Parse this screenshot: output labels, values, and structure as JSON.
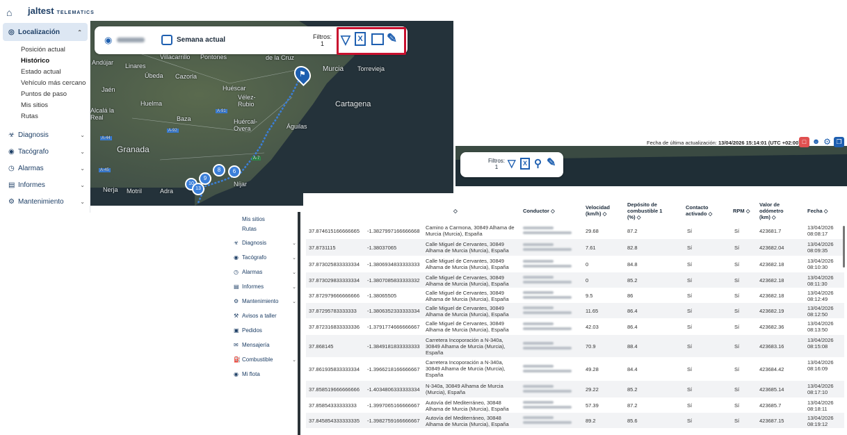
{
  "header": {
    "brand": "jaltest",
    "brand_tag": "TELEMATICS"
  },
  "sidebar": {
    "main_label": "Localización",
    "sub_items": [
      "Posición actual",
      "Histórico",
      "Estado actual",
      "Vehículo más cercano",
      "Puntos de paso",
      "Mis sitios",
      "Rutas"
    ],
    "items": [
      "Diagnosis",
      "Tacógrafo",
      "Alarmas",
      "Informes",
      "Mantenimiento"
    ]
  },
  "filter_bar": {
    "period": "Semana actual",
    "filters_label": "Filtros:",
    "filters_count": "1"
  },
  "map": {
    "labels": [
      "Andújar",
      "Linares",
      "Villacarrillo",
      "Pontones",
      "de la Cruz",
      "Murcia",
      "Torrevieja",
      "Jaén",
      "Úbeda",
      "Cazorla",
      "Huéscar",
      "Vélez-Rubio",
      "Cartagena",
      "Huelma",
      "Alcalá la Real",
      "Baza",
      "Huércal-Overa",
      "Águilas",
      "Granada",
      "Níjar",
      "Nerja",
      "Motril",
      "Adra",
      "A-44",
      "A-91",
      "A-7",
      "A-92",
      "A-45"
    ],
    "markers": [
      "10",
      "13",
      "9",
      "8",
      "6"
    ]
  },
  "update": {
    "label": "Fecha de última actualización:",
    "value": "13/04/2026 15:14:01 (UTC +02:00)"
  },
  "sidebar2": {
    "items": [
      "Mis sitios",
      "Rutas",
      "Diagnosis",
      "Tacógrafo",
      "Alarmas",
      "Informes",
      "Mantenimiento",
      "Avisos a taller",
      "Pedidos",
      "Mensajería",
      "Combustible",
      "Mi flota"
    ]
  },
  "table": {
    "headers": [
      "Conductor ◇",
      "Velocidad (km/h) ◇",
      "Depósito de combustible 1 (%) ◇",
      "Contacto activado ◇",
      "RPM ◇",
      "Valor de odómetro (km) ◇",
      "Fecha ◇"
    ],
    "rows": [
      {
        "lat": "37.874615166666665",
        "lon": "-1.3827997166666668",
        "addr": "Camino a Carmona, 30849 Alhama de Murcia (Murcia), España",
        "speed": "29.68",
        "fuel": "87.2",
        "contact": "Sí",
        "rpm": "Sí",
        "odo": "423681.7",
        "date": "13/04/2026",
        "time": "08:08:17"
      },
      {
        "lat": "37.8731115",
        "lon": "-1.38037065",
        "addr": "Calle Miguel de Cervantes, 30849 Alhama de Murcia (Murcia), España",
        "speed": "7.61",
        "fuel": "82.8",
        "contact": "Sí",
        "rpm": "Sí",
        "odo": "423682.04",
        "date": "13/04/2026",
        "time": "08:09:35"
      },
      {
        "lat": "37.873025833333334",
        "lon": "-1.3806934833333333",
        "addr": "Calle Miguel de Cervantes, 30849 Alhama de Murcia (Murcia), España",
        "speed": "0",
        "fuel": "84.8",
        "contact": "Sí",
        "rpm": "Sí",
        "odo": "423682.18",
        "date": "13/04/2026",
        "time": "08:10:30"
      },
      {
        "lat": "37.873029833333334",
        "lon": "-1.3807085833333332",
        "addr": "Calle Miguel de Cervantes, 30849 Alhama de Murcia (Murcia), España",
        "speed": "0",
        "fuel": "85.2",
        "contact": "Sí",
        "rpm": "Sí",
        "odo": "423682.18",
        "date": "13/04/2026",
        "time": "08:11:30"
      },
      {
        "lat": "37.872979666666666",
        "lon": "-1.38065505",
        "addr": "Calle Miguel de Cervantes, 30849 Alhama de Murcia (Murcia), España",
        "speed": "9.5",
        "fuel": "86",
        "contact": "Sí",
        "rpm": "Sí",
        "odo": "423682.18",
        "date": "13/04/2026",
        "time": "08:12:49"
      },
      {
        "lat": "37.87295783333333",
        "lon": "-1.3806352333333334",
        "addr": "Calle Miguel de Cervantes, 30849 Alhama de Murcia (Murcia), España",
        "speed": "11.65",
        "fuel": "86.4",
        "contact": "Sí",
        "rpm": "Sí",
        "odo": "423682.19",
        "date": "13/04/2026",
        "time": "08:12:50"
      },
      {
        "lat": "37.872316833333336",
        "lon": "-1.3791774666666667",
        "addr": "Calle Miguel de Cervantes, 30849 Alhama de Murcia (Murcia), España",
        "speed": "42.03",
        "fuel": "86.4",
        "contact": "Sí",
        "rpm": "Sí",
        "odo": "423682.36",
        "date": "13/04/2026",
        "time": "08:13:50"
      },
      {
        "lat": "37.868145",
        "lon": "-1.3849181833333333",
        "addr": "Carretera Incoporación a N-340a, 30849 Alhama de Murcia (Murcia), España",
        "speed": "70.9",
        "fuel": "88.4",
        "contact": "Sí",
        "rpm": "Sí",
        "odo": "423683.16",
        "date": "13/04/2026",
        "time": "08:15:08"
      },
      {
        "lat": "37.861935833333334",
        "lon": "-1.3966218166666667",
        "addr": "Carretera Incoporación a N-340a, 30849 Alhama de Murcia (Murcia), España",
        "speed": "49.28",
        "fuel": "84.4",
        "contact": "Sí",
        "rpm": "Sí",
        "odo": "423684.42",
        "date": "13/04/2026",
        "time": "08:16:09"
      },
      {
        "lat": "37.858519666666666",
        "lon": "-1.4034806333333334",
        "addr": "N-340a, 30849 Alhama de Murcia (Murcia), España",
        "speed": "29.22",
        "fuel": "85.2",
        "contact": "Sí",
        "rpm": "Sí",
        "odo": "423685.14",
        "date": "13/04/2026",
        "time": "08:17:10"
      },
      {
        "lat": "37.85854333333333",
        "lon": "-1.3997065166666667",
        "addr": "Autovía del Mediterráneo, 30848 Alhama de Murcia (Murcia), España",
        "speed": "57.39",
        "fuel": "87.2",
        "contact": "Sí",
        "rpm": "Sí",
        "odo": "423685.7",
        "date": "13/04/2026",
        "time": "08:18:11"
      },
      {
        "lat": "37.845854333333335",
        "lon": "-1.3982759166666667",
        "addr": "Autovía del Mediterráneo, 30848 Alhama de Murcia (Murcia), España",
        "speed": "89.2",
        "fuel": "85.6",
        "contact": "Sí",
        "rpm": "Sí",
        "odo": "423687.15",
        "date": "13/04/2026",
        "time": "08:19:12"
      }
    ]
  },
  "colors": {
    "accent": "#1e5fb0",
    "highlight": "#c8102e",
    "active_bg": "#dde7f3"
  }
}
